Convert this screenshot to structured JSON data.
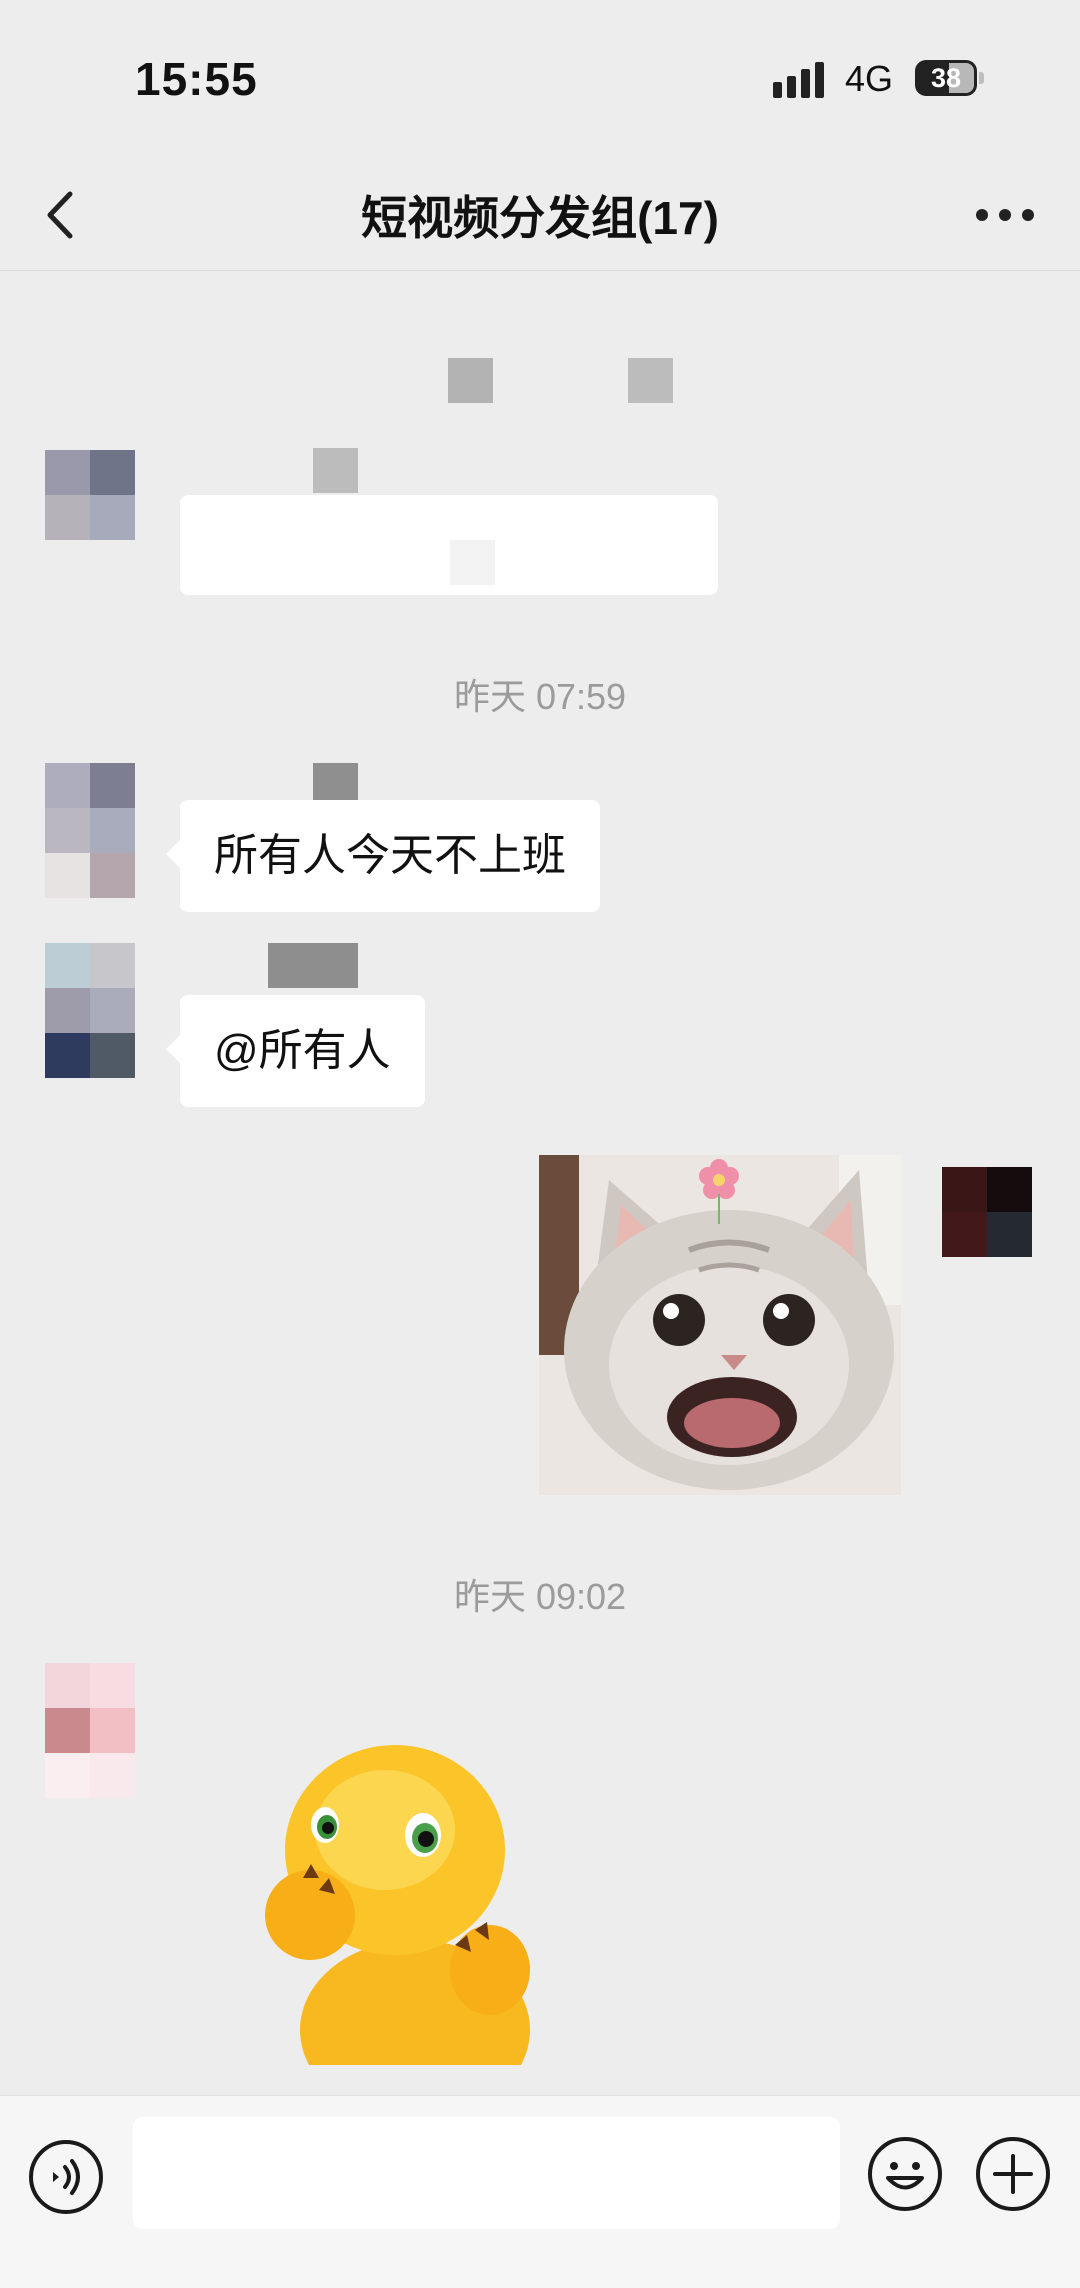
{
  "status_bar": {
    "time": "15:55",
    "network": "4G",
    "battery": "38"
  },
  "header": {
    "title": "短视频分发组(17)",
    "back_icon": "chevron-left-icon",
    "more_icon": "more-dots-icon"
  },
  "messages": [
    {
      "type": "text",
      "side": "left",
      "text": "所有人今天不上班"
    },
    {
      "type": "text",
      "side": "left",
      "text": "@所有人"
    },
    {
      "type": "sticker",
      "side": "right",
      "description_icon": "cat-sticker"
    },
    {
      "type": "sticker",
      "side": "left",
      "description_icon": "yellow-creature-sticker"
    }
  ],
  "timestamps": [
    "昨天 07:59",
    "昨天 09:02"
  ],
  "input_bar": {
    "voice_icon": "voice-icon",
    "emoji_icon": "emoji-icon",
    "plus_icon": "plus-icon"
  }
}
